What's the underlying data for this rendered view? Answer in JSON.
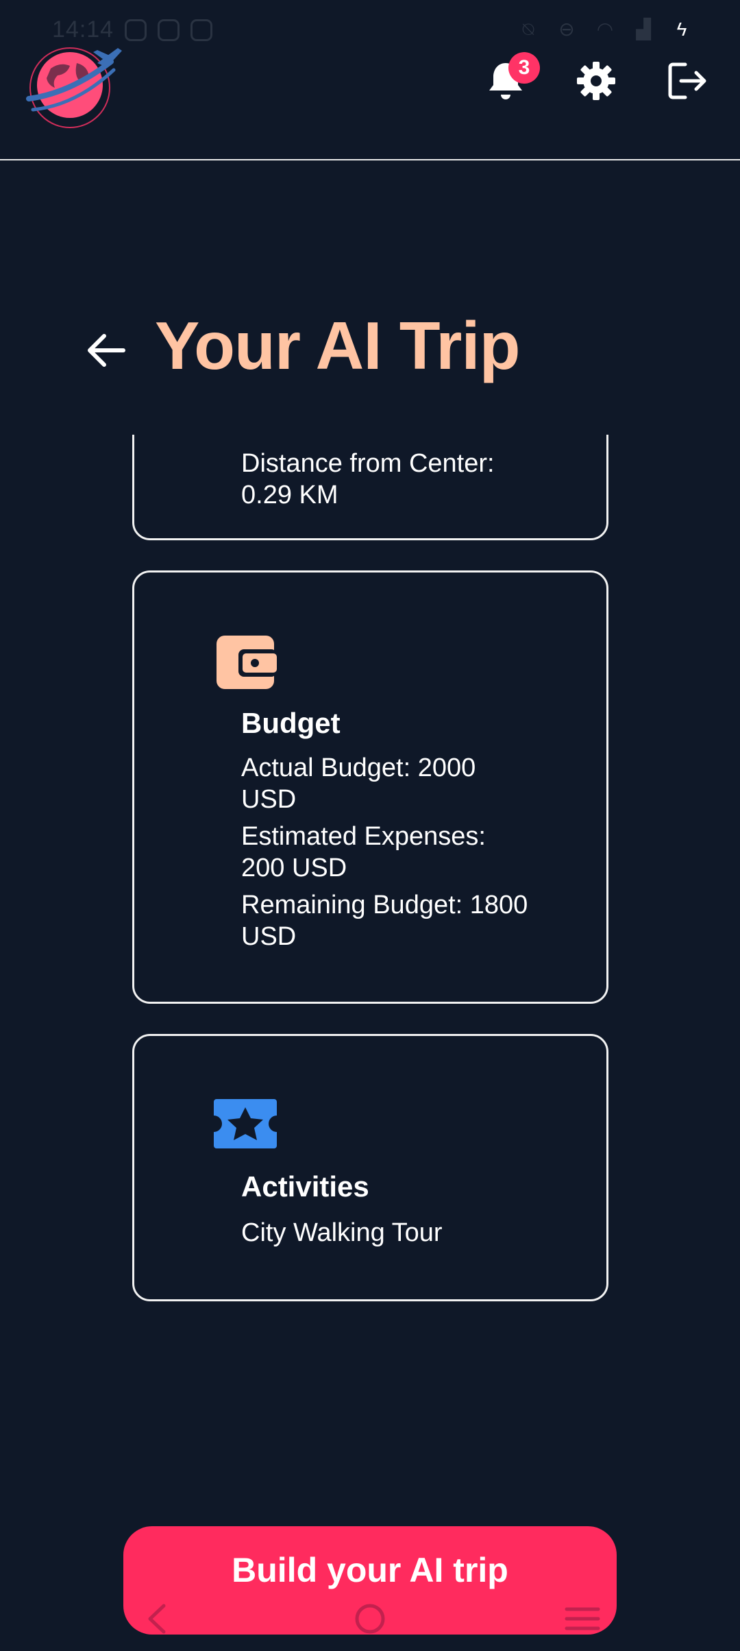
{
  "status_bar": {
    "time": "14:14",
    "left_icons": [
      "message-icon",
      "instagram-icon",
      "instagram-icon"
    ],
    "right_icons": [
      "bell-off-icon",
      "minus-circle-icon",
      "wifi-icon",
      "signal-icon",
      "battery-charging-icon"
    ]
  },
  "header": {
    "notification_count": "3",
    "colors": {
      "accent": "#ff3366",
      "background": "#0f1828"
    }
  },
  "title": {
    "text": "Your AI Trip",
    "color": "#ffc4a3"
  },
  "cards": {
    "hotel": {
      "distance_line1": "Distance from Center:",
      "distance_line2": "0.29 KM"
    },
    "budget": {
      "icon": "wallet-icon",
      "icon_color": "#ffc4a3",
      "heading": "Budget",
      "actual_line1": "Actual Budget: 2000",
      "actual_line2": "USD",
      "estimated_line1": "Estimated Expenses:",
      "estimated_line2": "200 USD",
      "remaining_line1": "Remaining Budget: 1800",
      "remaining_line2": "USD"
    },
    "activities": {
      "icon": "ticket-star-icon",
      "icon_color": "#3b8df0",
      "heading": "Activities",
      "item": "City Walking Tour"
    }
  },
  "build_button": {
    "label": "Build your AI trip",
    "color": "#ff2b5e"
  },
  "nav_bar": {
    "icons": [
      "back-icon",
      "home-icon",
      "menu-icon"
    ]
  }
}
